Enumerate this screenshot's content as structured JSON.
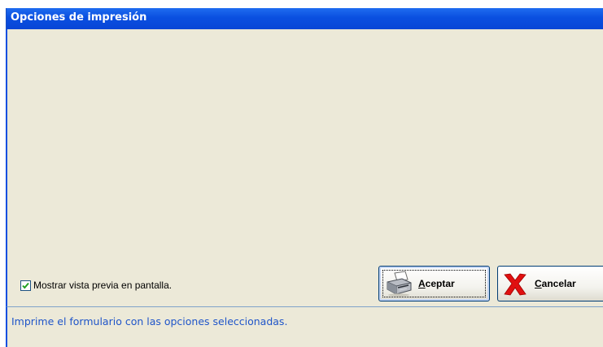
{
  "window": {
    "title": "Opciones de impresión"
  },
  "options": {
    "preview_checkbox_label": "Mostrar vista previa en pantalla.",
    "preview_checked": true
  },
  "buttons": {
    "accept_mnemonic": "A",
    "accept_rest": "ceptar",
    "accept_icon": "printer-icon",
    "cancel_mnemonic": "C",
    "cancel_rest": "ancelar",
    "cancel_icon": "red-x-icon"
  },
  "status": {
    "text": "Imprime el formulario con las opciones seleccionadas."
  },
  "colors": {
    "titlebar": "#0a4fe0",
    "dialog_bg": "#ece9d8",
    "status_text": "#1f55c9",
    "cancel_x": "#e01010"
  }
}
